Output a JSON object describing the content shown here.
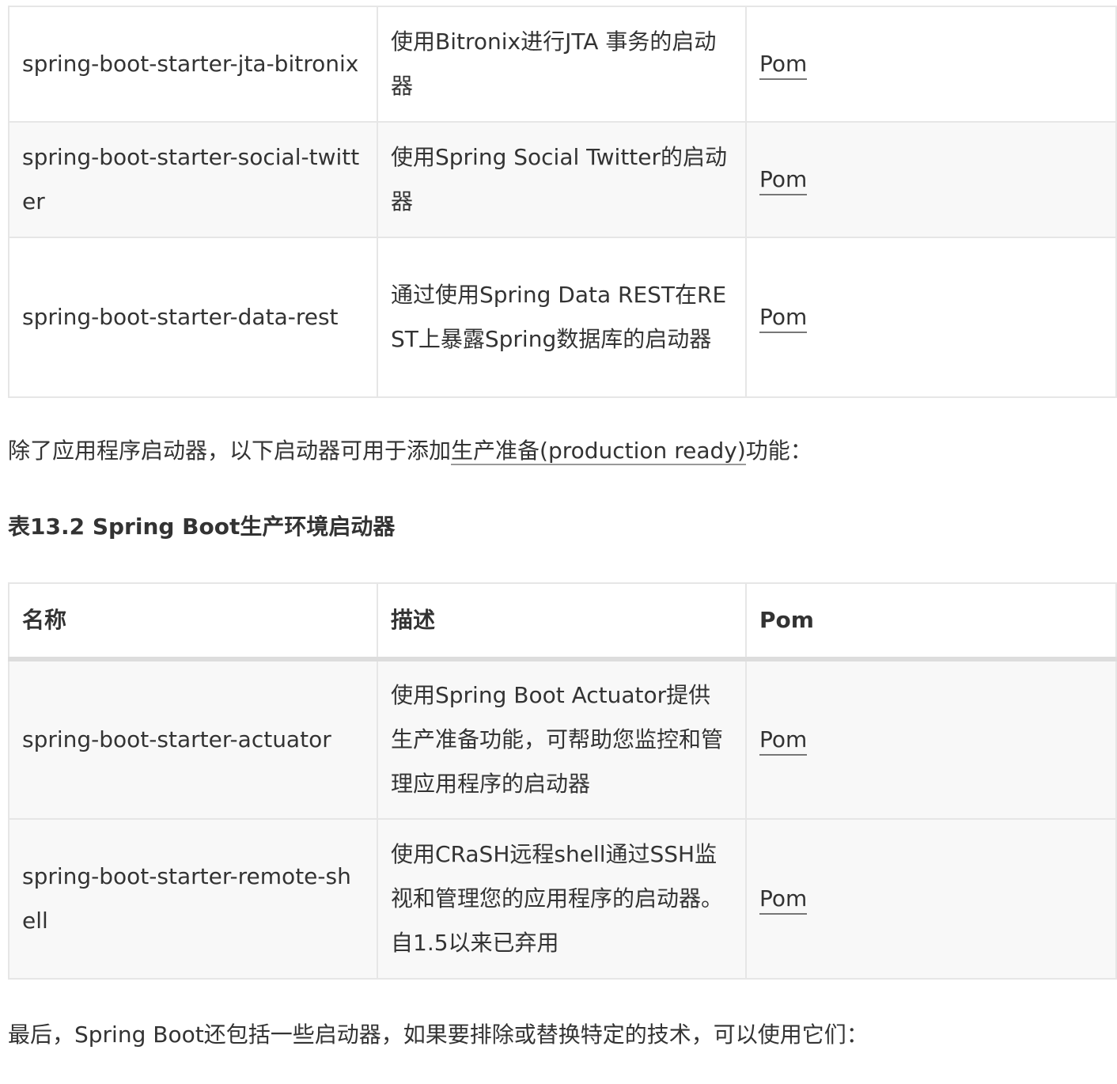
{
  "table1": {
    "rows": [
      {
        "name": "spring-boot-starter-jta-bitronix",
        "desc": "使用Bitronix进行JTA 事务的启动器",
        "pom": "Pom"
      },
      {
        "name": "spring-boot-starter-social-twitter",
        "desc": "使用Spring Social Twitter的启动器",
        "pom": "Pom"
      },
      {
        "name": "spring-boot-starter-data-rest",
        "desc": "通过使用Spring Data REST在REST上暴露Spring数据库的启动器",
        "pom": "Pom"
      }
    ]
  },
  "paragraph1": {
    "before": "除了应用程序启动器，以下启动器可用于添加",
    "link": "生产准备(production ready)",
    "after": "功能："
  },
  "table2": {
    "caption": "表13.2 Spring Boot生产环境启动器",
    "headers": {
      "name": "名称",
      "desc": "描述",
      "pom": "Pom"
    },
    "rows": [
      {
        "name": "spring-boot-starter-actuator",
        "desc": "使用Spring Boot Actuator提供生产准备功能，可帮助您监控和管理应用程序的启动器",
        "pom": "Pom"
      },
      {
        "name": "spring-boot-starter-remote-shell",
        "desc": "使用CRaSH远程shell通过SSH监视和管理您的应用程序的启动器。 自1.5以来已弃用",
        "pom": "Pom"
      }
    ]
  },
  "paragraph2": {
    "text": "最后，Spring Boot还包括一些启动器，如果要排除或替换特定的技术，可以使用它们："
  }
}
